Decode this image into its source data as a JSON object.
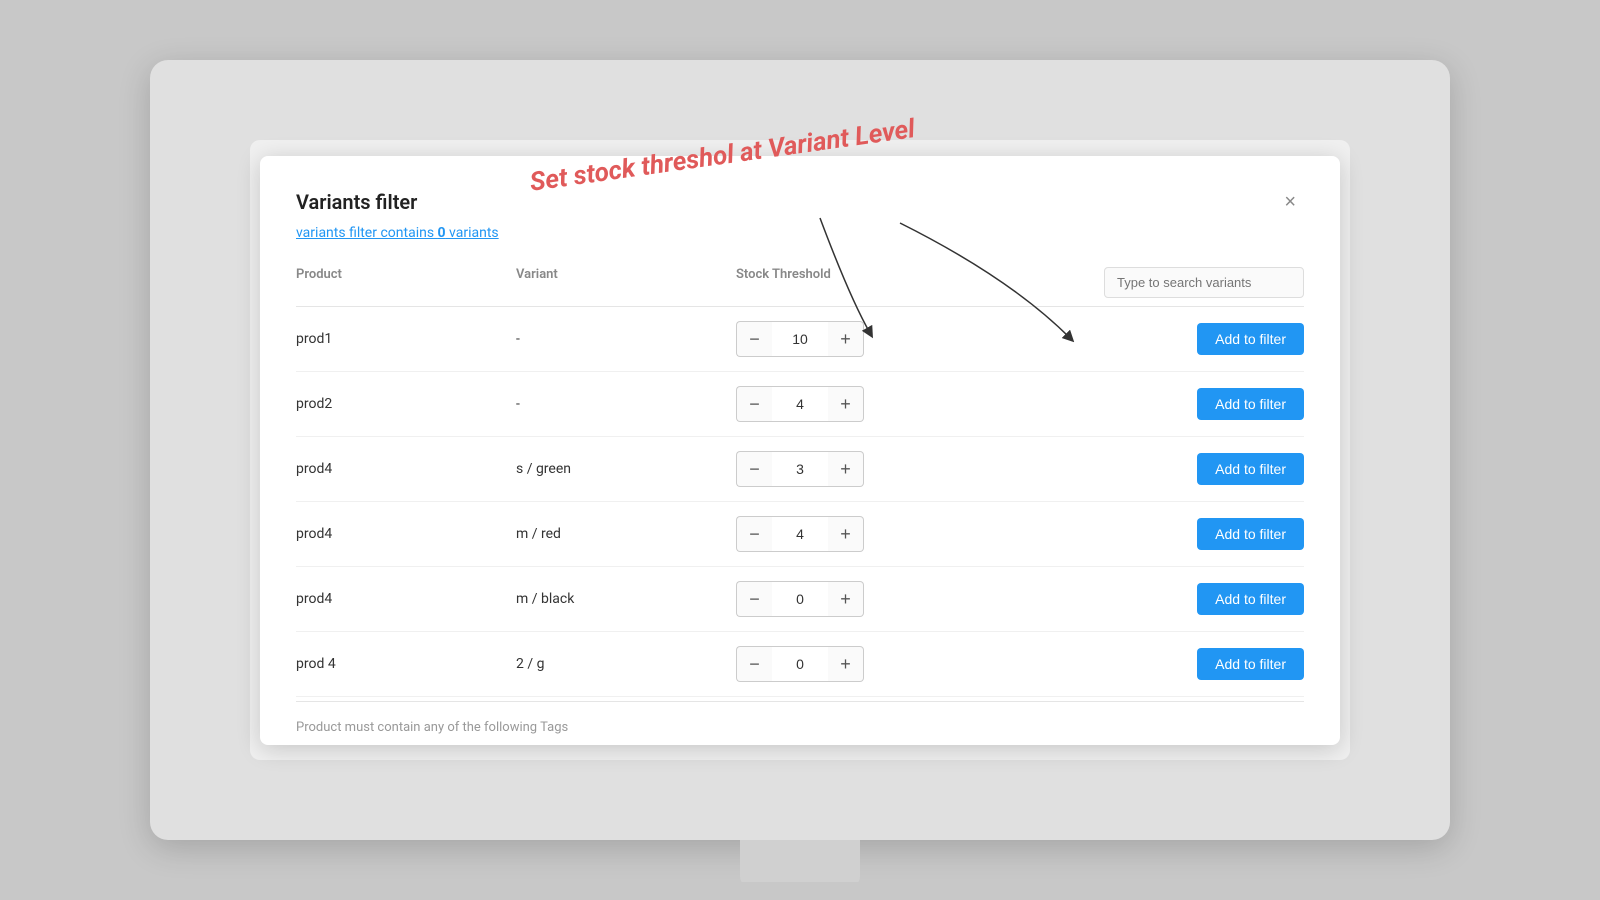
{
  "modal": {
    "title": "Variants filter",
    "close_label": "×",
    "filter_link_text": "variants filter contains ",
    "filter_count": "0",
    "filter_link_suffix": " variants",
    "columns": {
      "product": "Product",
      "variant": "Variant",
      "stock_threshold": "Stock Threshold",
      "search_placeholder": "Type to search variants"
    },
    "rows": [
      {
        "product": "prod1",
        "variant": "-",
        "value": "10"
      },
      {
        "product": "prod2",
        "variant": "-",
        "value": "4"
      },
      {
        "product": "prod4",
        "variant": "s / green",
        "value": "3"
      },
      {
        "product": "prod4",
        "variant": "m / red",
        "value": "4"
      },
      {
        "product": "prod4",
        "variant": "m / black",
        "value": "0"
      },
      {
        "product": "prod 4",
        "variant": "2 / g",
        "value": "0"
      }
    ],
    "add_filter_label": "Add to filter",
    "footer_text": "Product must contain any of the following Tags",
    "annotation": {
      "text": "Set stock threshol at Variant Level"
    }
  }
}
